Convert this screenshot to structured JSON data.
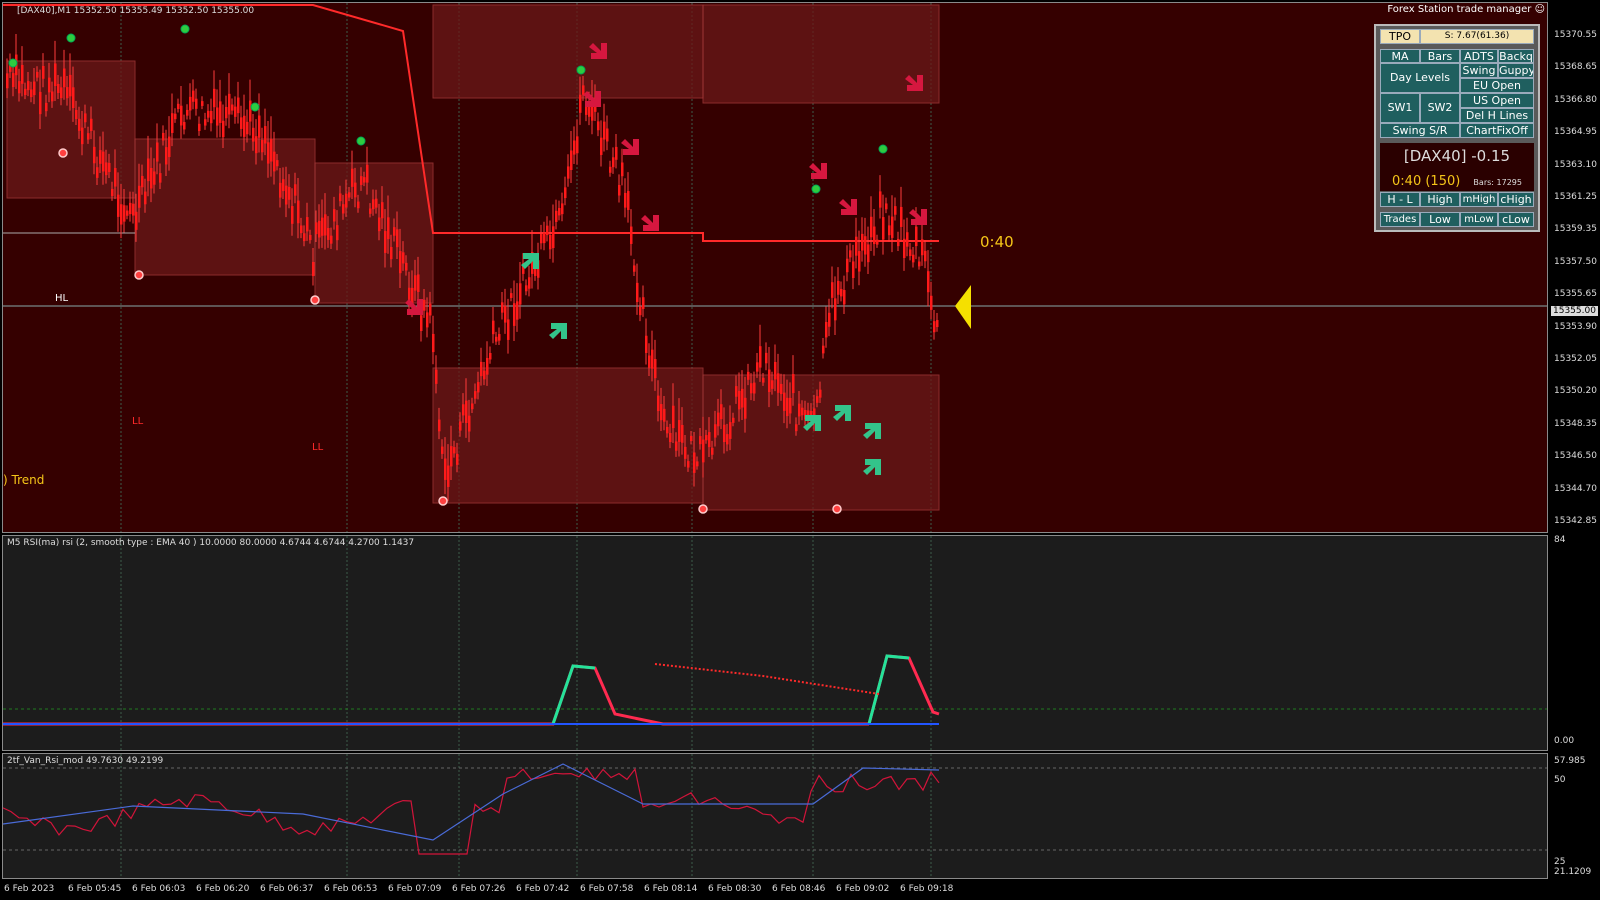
{
  "chart": {
    "symbol_info": "[DAX40],M1  15352.50 15355.49 15352.50 15355.00",
    "countdown": "0:40",
    "labels": {
      "hl": "HL",
      "ll1": "LL",
      "ll2": "LL",
      "trend": ") Trend"
    },
    "price_ticks": [
      "15370.55",
      "15368.65",
      "15366.80",
      "15364.95",
      "15363.10",
      "15361.25",
      "15359.35",
      "15357.50",
      "15355.65",
      "15353.90",
      "15352.05",
      "15350.20",
      "15348.35",
      "15346.50",
      "15344.70",
      "15342.85"
    ],
    "current_price": "15355.00",
    "colors": {
      "background": "#350000",
      "candle": "#ff1a1a",
      "arrow_down": "#d6173f",
      "arrow_up": "#33c48a",
      "marker": "#1f9e2f"
    }
  },
  "rsi_pane": {
    "title": "M5 RSI(ma) rsi (2, smooth type : EMA  40 ) 10.0000 80.0000 4.6744 4.6744 4.2700 1.1437",
    "top_tick": "84",
    "bottom_tick": "0.00"
  },
  "van_pane": {
    "title": "2tf_Van_Rsi_mod 49.7630 49.2199",
    "ticks": [
      "57.985",
      "50",
      "25",
      "21.1209"
    ],
    "colors": {
      "line1": "#d1143a",
      "line2": "#4a6bd8"
    }
  },
  "time_axis": [
    "6 Feb 2023",
    "6 Feb 05:45",
    "6 Feb 06:03",
    "6 Feb 06:20",
    "6 Feb 06:37",
    "6 Feb 06:53",
    "6 Feb 07:09",
    "6 Feb 07:26",
    "6 Feb 07:42",
    "6 Feb 07:58",
    "6 Feb 08:14",
    "6 Feb 08:30",
    "6 Feb 08:46",
    "6 Feb 09:02",
    "6 Feb 09:18"
  ],
  "trade_manager": {
    "title": "Forex Station trade manager",
    "tpo": "TPO",
    "tpo_value": "S: 7.67(61.36)",
    "buttons": {
      "ma": "MA",
      "bars": "Bars",
      "adts": "ADTS",
      "backq": "Backq",
      "day_levels": "Day Levels",
      "swing": "Swing",
      "guppy": "Guppy",
      "eu_open": "EU Open",
      "sw1": "SW1",
      "sw2": "SW2",
      "us_open": "US Open",
      "del_h_lines": "Del H Lines",
      "swing_sr": "Swing S/R",
      "chartfixoff": "ChartFixOff",
      "h_l": "H - L",
      "high": "High",
      "mhigh": "mHigh",
      "chigh": "cHigh",
      "trades": "Trades",
      "low": "Low",
      "mlow": "mLow",
      "clow": "cLow"
    },
    "symbol_change": "[DAX40] -0.15",
    "timer": "0:40 (150)",
    "bars": "Bars: 17295"
  }
}
